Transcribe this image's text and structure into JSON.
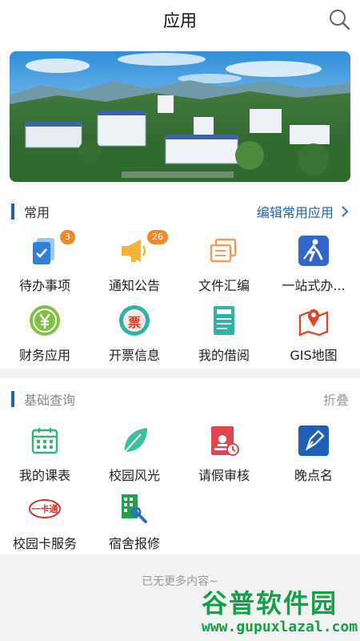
{
  "header": {
    "title": "应用",
    "search_icon": "search-icon"
  },
  "banner": {
    "alt": "campus-aerial-photo"
  },
  "common": {
    "title": "常用",
    "edit_label": "编辑常用应用",
    "edit_icon": "chevron-right-icon",
    "items": [
      {
        "label": "待办事项",
        "icon": "todo-icon",
        "badge": "3"
      },
      {
        "label": "通知公告",
        "icon": "megaphone-icon",
        "badge": "26"
      },
      {
        "label": "文件汇编",
        "icon": "documents-icon"
      },
      {
        "label": "一站式办...",
        "icon": "one-stop-service-icon"
      },
      {
        "label": "财务应用",
        "icon": "finance-yuan-icon"
      },
      {
        "label": "开票信息",
        "icon": "invoice-icon",
        "icon_text": "票"
      },
      {
        "label": "我的借阅",
        "icon": "book-icon"
      },
      {
        "label": "GIS地图",
        "icon": "map-pin-icon"
      }
    ]
  },
  "basic": {
    "title": "基础查询",
    "collapse_label": "折叠",
    "items": [
      {
        "label": "我的课表",
        "icon": "calendar-icon"
      },
      {
        "label": "校园风光",
        "icon": "leaf-icon"
      },
      {
        "label": "请假审核",
        "icon": "leave-approval-icon"
      },
      {
        "label": "晚点名",
        "icon": "pen-icon"
      },
      {
        "label": "校园卡服务",
        "icon": "campus-card-icon",
        "icon_text": "一卡通"
      },
      {
        "label": "宿舍报修",
        "icon": "dorm-repair-icon"
      }
    ]
  },
  "footer": {
    "end_text": "已无更多内容~"
  },
  "watermark": {
    "title": "谷普软件园",
    "url": "www.gupuxlazal.com"
  },
  "colors": {
    "accent": "#1e62b3",
    "badge": "#f08a24",
    "divider": "#f2f2f2",
    "watermark": "#13a048"
  }
}
